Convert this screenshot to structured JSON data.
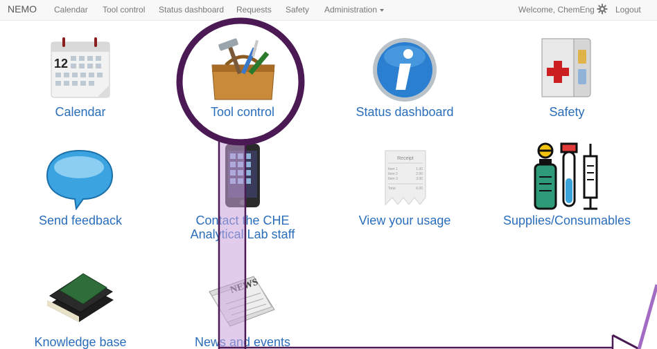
{
  "navbar": {
    "brand": "NEMO",
    "items": [
      "Calendar",
      "Tool control",
      "Status dashboard",
      "Requests",
      "Safety",
      "Administration"
    ],
    "welcome": "Welcome, ChemEng",
    "logout": "Logout"
  },
  "tiles": [
    {
      "label": "Calendar"
    },
    {
      "label": "Tool control"
    },
    {
      "label": "Status dashboard"
    },
    {
      "label": "Safety"
    },
    {
      "label": "Send feedback"
    },
    {
      "label": "Contact the CHE"
    },
    {
      "label": "View your usage"
    },
    {
      "label": "Supplies/Consumables"
    },
    {
      "label": "Knowledge base"
    },
    {
      "label": "News and events"
    }
  ],
  "contact_line2": "Analytical Lab staff",
  "calendar_icon": {
    "number": "12"
  },
  "receipt_icon": {
    "title": "Receipt",
    "rows": [
      [
        "Item 1",
        "1.00"
      ],
      [
        "Item 2",
        "2.00"
      ],
      [
        "Item 3",
        "3.00"
      ]
    ],
    "total": [
      "Total",
      "6.00"
    ]
  },
  "news_icon": {
    "text": "NEWS"
  },
  "colors": {
    "link": "#2a6ebb",
    "annotation_circle": "#4b1a55",
    "annotation_bar": "#c9a3dc"
  }
}
